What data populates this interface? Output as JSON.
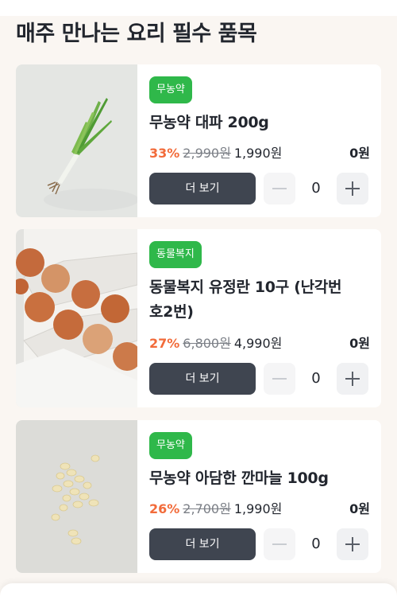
{
  "section": {
    "title": "매주 만나는 요리 필수 품목"
  },
  "products": [
    {
      "badge": "무농약",
      "name": "무농약 대파 200g",
      "discount": "33%",
      "original_price": "2,990원",
      "sale_price": "1,990원",
      "total": "0원",
      "more_label": "더 보기",
      "quantity": "0",
      "image": "green-onion-image"
    },
    {
      "badge": "동물복지",
      "name_line1": "동물복지 유정란 10구 (난각번",
      "name_line2": "호2번)",
      "discount": "27%",
      "original_price": "6,800원",
      "sale_price": "4,990원",
      "total": "0원",
      "more_label": "더 보기",
      "quantity": "0",
      "image": "eggs-carton-image"
    },
    {
      "badge": "무농약",
      "name": "무농약 아담한 깐마늘 100g",
      "discount": "26%",
      "original_price": "2,700원",
      "sale_price": "1,990원",
      "total": "0원",
      "more_label": "더 보기",
      "quantity": "0",
      "image": "peeled-garlic-image"
    }
  ],
  "colors": {
    "badge_green": "#2fb84a",
    "discount_orange": "#f26b3a",
    "button_dark": "#3f4550",
    "background": "#faf6f2"
  }
}
